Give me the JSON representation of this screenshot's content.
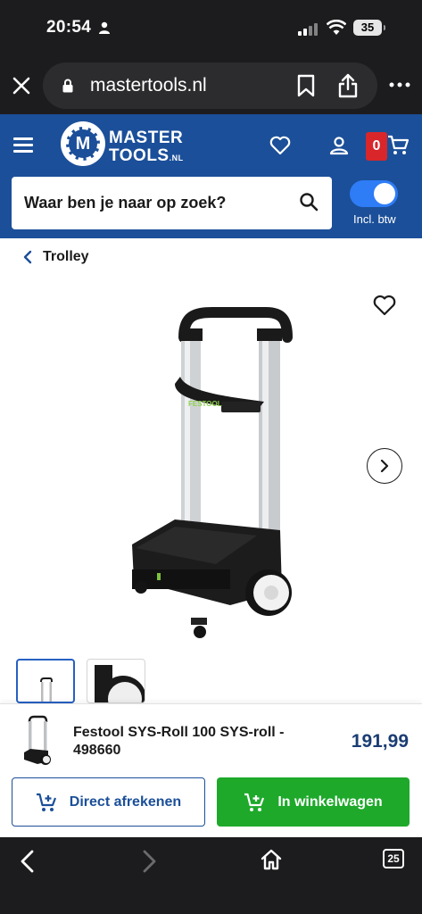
{
  "status_bar": {
    "time": "20:54",
    "battery": "35"
  },
  "browser": {
    "url": "mastertools.nl",
    "tab_count": "25"
  },
  "header": {
    "logo_line1": "MASTER",
    "logo_line2": "TOOLS",
    "logo_suffix": ".NL",
    "logo_mark": "M",
    "cart_count": "0",
    "search_placeholder": "Waar ben je naar op zoek?",
    "vat_toggle_label": "Incl. btw",
    "vat_toggle_on": true
  },
  "breadcrumb": {
    "label": "Trolley"
  },
  "product": {
    "title": "Festool SYS-Roll 100 SYS-roll - 498660",
    "price": "191,99",
    "image_label": "FESTOOL"
  },
  "actions": {
    "direct_checkout": "Direct afrekenen",
    "add_to_cart": "In winkelwagen"
  },
  "colors": {
    "brand_blue": "#1b4f99",
    "cart_red": "#d9262b",
    "cta_green": "#1ea92b",
    "price_navy": "#1b3c73"
  }
}
